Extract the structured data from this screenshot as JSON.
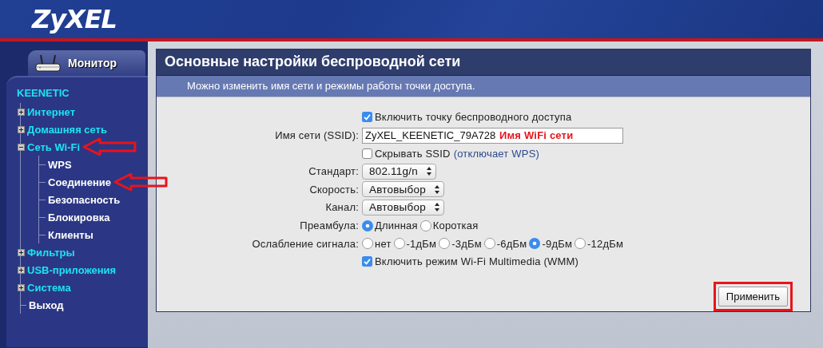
{
  "header": {
    "logo": "ZyXEL"
  },
  "sidebar": {
    "tab": {
      "label": "Монитор"
    },
    "title": "KEENETIC",
    "items": [
      {
        "kind": "folder",
        "label": "Интернет",
        "expanded": false
      },
      {
        "kind": "folder",
        "label": "Домашняя сеть",
        "expanded": false
      },
      {
        "kind": "folder",
        "label": "Сеть Wi-Fi",
        "expanded": true,
        "arrow": true,
        "children": [
          {
            "label": "WPS"
          },
          {
            "label": "Соединение",
            "arrow": true
          },
          {
            "label": "Безопасность"
          },
          {
            "label": "Блокировка"
          },
          {
            "label": "Клиенты"
          }
        ]
      },
      {
        "kind": "folder",
        "label": "Фильтры",
        "expanded": false
      },
      {
        "kind": "folder",
        "label": "USB-приложения",
        "expanded": false
      },
      {
        "kind": "folder",
        "label": "Система",
        "expanded": false
      },
      {
        "kind": "link",
        "label": "Выход"
      }
    ]
  },
  "panel": {
    "title": "Основные настройки беспроводной сети",
    "subtitle": "Можно изменить имя сети и режимы работы точки доступа.",
    "rows": [
      {
        "kind": "checkbox",
        "label": "Включить точку беспроводного доступа",
        "checked": true
      },
      {
        "kind": "text",
        "label": "Имя сети (SSID):",
        "value": "ZyXEL_KEENETIC_79A728",
        "note": "Имя WiFi сети"
      },
      {
        "kind": "checkbox",
        "label": "Скрывать SSID",
        "hint": "(отключает WPS)",
        "checked": false
      },
      {
        "kind": "select",
        "label": "Стандарт:",
        "value": "802.11g/n"
      },
      {
        "kind": "select",
        "label": "Скорость:",
        "value": "Автовыбор"
      },
      {
        "kind": "select",
        "label": "Канал:",
        "value": "Автовыбор"
      },
      {
        "kind": "radio",
        "label": "Преамбула:",
        "options": [
          {
            "label": "Длинная",
            "selected": true
          },
          {
            "label": "Короткая",
            "selected": false
          }
        ]
      },
      {
        "kind": "radio",
        "label": "Ослабление сигнала:",
        "options": [
          {
            "label": "нет",
            "selected": false
          },
          {
            "label": "-1дБм",
            "selected": false
          },
          {
            "label": "-3дБм",
            "selected": false
          },
          {
            "label": "-6дБм",
            "selected": false
          },
          {
            "label": "-9дБм",
            "selected": true
          },
          {
            "label": "-12дБм",
            "selected": false
          }
        ]
      },
      {
        "kind": "checkbox",
        "label": "Включить режим Wi-Fi Multimedia (WMM)",
        "checked": true
      }
    ],
    "button": {
      "label": "Применить",
      "highlighted": true
    }
  }
}
